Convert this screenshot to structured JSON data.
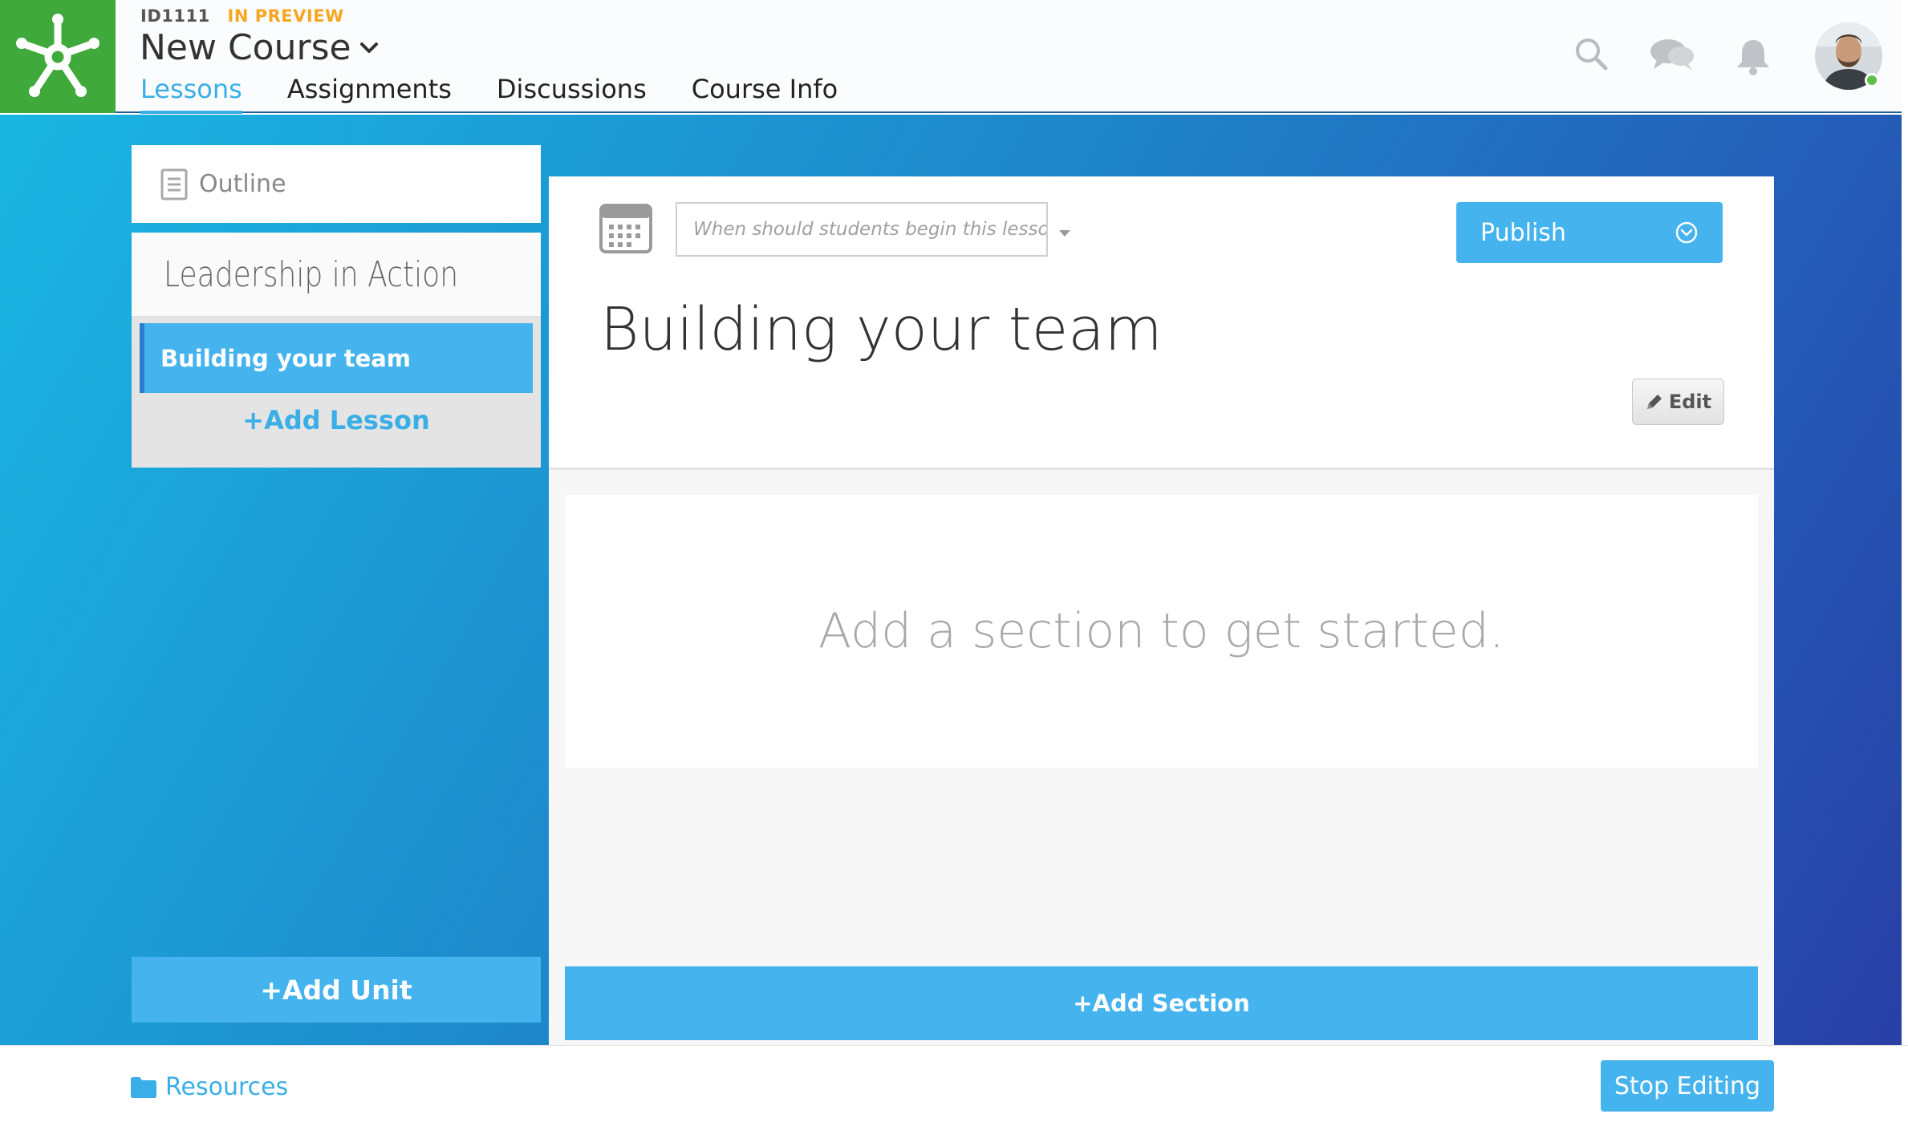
{
  "header": {
    "course_id": "ID1111",
    "course_status": "IN PREVIEW",
    "course_title": "New Course",
    "tabs": [
      {
        "label": "Lessons",
        "active": true
      },
      {
        "label": "Assignments",
        "active": false
      },
      {
        "label": "Discussions",
        "active": false
      },
      {
        "label": "Course Info",
        "active": false
      }
    ],
    "icons": [
      "search-icon",
      "chat-icon",
      "bell-icon"
    ],
    "user_status": "online"
  },
  "sidebar": {
    "outline_label": "Outline",
    "unit_title": "Leadership in Action",
    "lessons": [
      {
        "label": "Building your team",
        "selected": true
      }
    ],
    "add_lesson_label": "+Add Lesson",
    "add_unit_label": "+Add Unit"
  },
  "lesson": {
    "date_placeholder": "When should students begin this lesson?",
    "publish_label": "Publish",
    "title": "Building your team",
    "edit_label": "Edit",
    "empty_message": "Add a section to get started.",
    "add_section_label": "+Add Section"
  },
  "footer": {
    "resources_label": "Resources",
    "stop_editing_label": "Stop Editing"
  },
  "colors": {
    "accent": "#45b3ee",
    "accent_text": "#3aaee6",
    "brand_green": "#3fa93b",
    "preview_orange": "#f5a623",
    "gradient_start": "#1ab6e2",
    "gradient_end": "#283fa5"
  }
}
